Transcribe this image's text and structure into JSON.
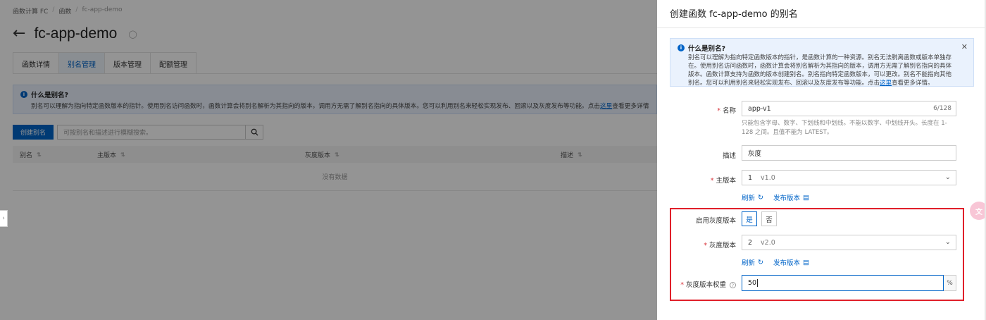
{
  "breadcrumb": {
    "items": [
      "函数计算 FC",
      "函数",
      "fc-app-demo"
    ],
    "sep": "/"
  },
  "page": {
    "title": "fc-app-demo"
  },
  "tabs": [
    "函数详情",
    "别名管理",
    "版本管理",
    "配额管理"
  ],
  "bg_info": {
    "title": "什么是别名?",
    "text": "别名可以理解为指向特定函数版本的指针。使用别名访问函数时，函数计算会将别名解析为其指向的版本，调用方无需了解别名指向的具体版本。您可以利用别名来轻松实现发布、回滚以及灰度发布等功能。点击",
    "link": "这里",
    "tail": "查看更多详情。"
  },
  "toolbar": {
    "create_label": "创建别名",
    "search_placeholder": "可按别名和描述进行模糊搜索。"
  },
  "table": {
    "headers": [
      "别名",
      "主版本",
      "灰度版本",
      "描述"
    ],
    "empty": "没有数据"
  },
  "drawer": {
    "title": "创建函数 fc-app-demo 的别名",
    "info": {
      "title": "什么是别名?",
      "text": "别名可以理解为指向特定函数版本的指针，是函数计算的一种资源。别名无法脱离函数或版本单独存在。使用别名访问函数时，函数计算会将别名解析为其指向的版本，调用方无需了解别名指向的具体版本。函数计算支持为函数的版本创建别名。别名指向特定函数版本，可以更改。别名不能指向其他别名。您可以利用别名来轻松实现发布、回滚以及灰度发布等功能。点击",
      "link": "这里",
      "tail": "查看更多详情。"
    },
    "form": {
      "name_label": "名称",
      "name_value": "app-v1",
      "name_count": "6/128",
      "name_hint": "只能包含字母、数字、下划线和中划线。不能以数字、中划线开头。长度在 1-128 之间。且值不能为 LATEST。",
      "desc_label": "描述",
      "desc_value": "灰度",
      "main_version_label": "主版本",
      "main_version_num": "1",
      "main_version_name": "v1.0",
      "refresh_label": "刷新",
      "publish_label": "发布版本",
      "gray_enable_label": "启用灰度版本",
      "gray_yes": "是",
      "gray_no": "否",
      "gray_version_label": "灰度版本",
      "gray_version_num": "2",
      "gray_version_name": "v2.0",
      "gray_weight_label": "灰度版本权重",
      "gray_weight_value": "50",
      "gray_weight_unit": "%"
    }
  },
  "colors": {
    "accent": "#0064c8",
    "highlight": "#e0202a",
    "required": "#d9363e"
  }
}
